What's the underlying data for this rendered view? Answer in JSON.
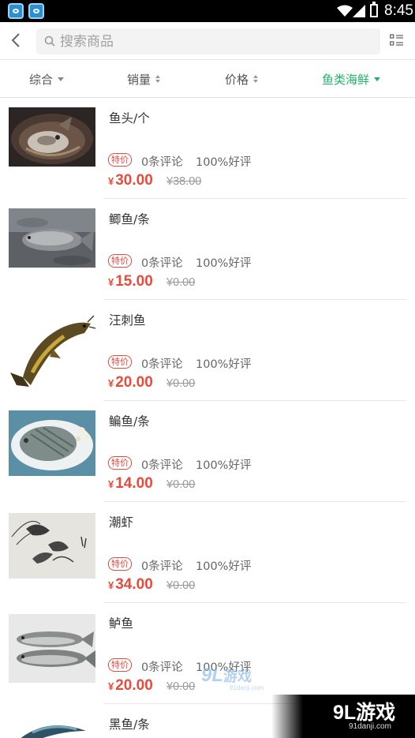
{
  "status_bar": {
    "time": "8:45"
  },
  "search": {
    "placeholder": "搜索商品",
    "value": ""
  },
  "filters": [
    {
      "label": "综合",
      "arrow": "down"
    },
    {
      "label": "销量",
      "arrow": "updown"
    },
    {
      "label": "价格",
      "arrow": "updown"
    },
    {
      "label": "鱼类海鲜",
      "arrow": "down",
      "active": true
    }
  ],
  "colors": {
    "accent": "#1fb36a",
    "price": "#e84b3c",
    "muted": "#999999"
  },
  "products": [
    {
      "name": "鱼头/个",
      "tag": "特价",
      "reviews": "0条评论",
      "rating": "100%好评",
      "currency": "¥",
      "price": "30.00",
      "old_price": "¥38.00",
      "image": "fish-head-in-pot"
    },
    {
      "name": "鲫鱼/条",
      "tag": "特价",
      "reviews": "0条评论",
      "rating": "100%好评",
      "currency": "¥",
      "price": "15.00",
      "old_price": "¥0.00",
      "image": "crucian-carp-in-tank"
    },
    {
      "name": "汪刺鱼",
      "tag": "特价",
      "reviews": "0条评论",
      "rating": "100%好评",
      "currency": "¥",
      "price": "20.00",
      "old_price": "¥0.00",
      "image": "yellow-catfish"
    },
    {
      "name": "鳊鱼/条",
      "tag": "特价",
      "reviews": "0条评论",
      "rating": "100%好评",
      "currency": "¥",
      "price": "14.00",
      "old_price": "¥0.00",
      "image": "bream-on-plate"
    },
    {
      "name": "潮虾",
      "tag": "特价",
      "reviews": "0条评论",
      "rating": "100%好评",
      "currency": "¥",
      "price": "34.00",
      "old_price": "¥0.00",
      "image": "shrimp-ink-painting"
    },
    {
      "name": "鲈鱼",
      "tag": "特价",
      "reviews": "0条评论",
      "rating": "100%好评",
      "currency": "¥",
      "price": "20.00",
      "old_price": "¥0.00",
      "image": "two-sea-bass"
    },
    {
      "name": "黑鱼/条",
      "image": "snakehead-fish"
    }
  ],
  "watermark": {
    "logo_small": "9L",
    "logo_small_cn": "游戏",
    "logo_small_url": "91danji.com",
    "logo": "9L游戏",
    "url": "91danji.com"
  }
}
